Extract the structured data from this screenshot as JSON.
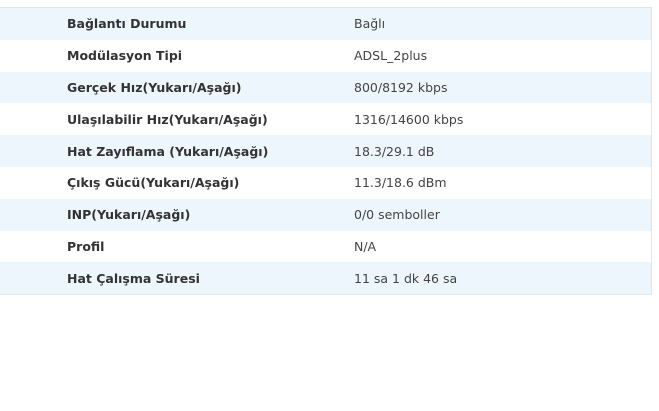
{
  "status_table": {
    "rows": [
      {
        "label": "Bağlantı Durumu",
        "value": "Bağlı"
      },
      {
        "label": "Modülasyon Tipi",
        "value": "ADSL_2plus"
      },
      {
        "label": "Gerçek Hız(Yukarı/Aşağı)",
        "value": "800/8192 kbps"
      },
      {
        "label": "Ulaşılabilir Hız(Yukarı/Aşağı)",
        "value": "1316/14600 kbps"
      },
      {
        "label": "Hat Zayıflama (Yukarı/Aşağı)",
        "value": "18.3/29.1 dB"
      },
      {
        "label": "Çıkış Gücü(Yukarı/Aşağı)",
        "value": "11.3/18.6 dBm"
      },
      {
        "label": "INP(Yukarı/Aşağı)",
        "value": "0/0 semboller"
      },
      {
        "label": "Profil",
        "value": "N/A"
      },
      {
        "label": "Hat Çalışma Süresi",
        "value": "11 sa 1 dk 46 sa"
      }
    ]
  },
  "colors": {
    "row_alt_background": "#eef6fd",
    "border": "#dfe6ee",
    "label_text": "#333333",
    "value_text": "#444444"
  }
}
